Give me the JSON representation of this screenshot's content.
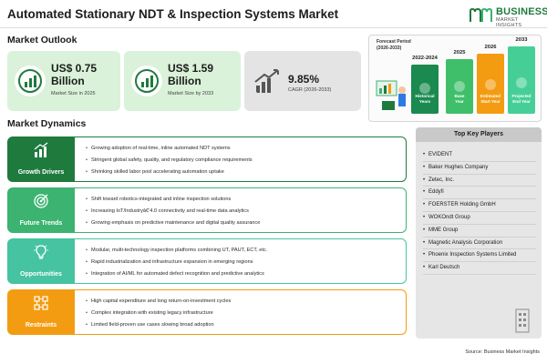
{
  "title": "Automated Stationary NDT & Inspection Systems Market",
  "logo": {
    "line1": "BUSINESS",
    "line2": "MARKET INSIGHTS",
    "brand_color": "#1f7a3e"
  },
  "outlook": {
    "heading": "Market Outlook",
    "cards": [
      {
        "value": "US$ 0.75 Billion",
        "value_line1": "US$ 0.75",
        "value_line2": "Billion",
        "caption": "Market Size in 2025",
        "bg": "#d9f2d9",
        "icon": "chart-circle-icon"
      },
      {
        "value": "US$ 1.59 Billion",
        "value_line1": "US$ 1.59",
        "value_line2": "Billion",
        "caption": "Market Size by 2033",
        "bg": "#d9f2d9",
        "icon": "chart-circle-icon"
      },
      {
        "value": "9.85%",
        "caption": "CAGR (2026-2033)",
        "bg": "#e4e4e4",
        "icon": "trend-up-icon"
      }
    ]
  },
  "forecast": {
    "label_line1": "Forecast Period",
    "label_line2": "(2026-2033)",
    "bars": [
      {
        "year": "2022-2024",
        "text_line1": "Historical",
        "text_line2": "Years",
        "color": "#1a8a50"
      },
      {
        "year": "2025",
        "text_line1": "Base",
        "text_line2": "Year",
        "color": "#3fbf6a"
      },
      {
        "year": "2026",
        "text_line1": "Estimated",
        "text_line2": "Start Year",
        "color": "#f39c12"
      },
      {
        "year": "2033",
        "text_line1": "Projected",
        "text_line2": "End Year",
        "color": "#45cf96"
      }
    ]
  },
  "dynamics": {
    "heading": "Market Dynamics",
    "groups": [
      {
        "label": "Growth Drivers",
        "color": "#1f7a3e",
        "border": "#1f7a3e",
        "icon": "growth-chart-icon",
        "items": [
          "Growing adoption of real-time, inline automated NDT systems",
          "Stringent global safety, quality, and regulatory compliance requirements",
          "Shrinking skilled labor pool accelerating automation uptake"
        ]
      },
      {
        "label": "Future Trends",
        "color": "#3cb371",
        "border": "#3cb371",
        "icon": "target-icon",
        "items": [
          "Shift toward robotics-integrated and inline inspection solutions",
          "Increasing IoT/Industryâ€‘4.0 connectivity and real-time data analytics",
          "Growing emphasis on predictive maintenance and digital quality assurance"
        ]
      },
      {
        "label": "Opportunities",
        "color": "#46c3a0",
        "border": "#46c3a0",
        "icon": "lightbulb-icon",
        "items": [
          "Modular, multi-technology inspection platforms combining UT, PAUT, ECT, etc.",
          "Rapid industrialization and infrastructure expansion in emerging regions",
          "Integration of AI/ML for automated defect recognition and predictive analytics"
        ]
      },
      {
        "label": "Restraints",
        "color": "#f39c12",
        "border": "#f39c12",
        "icon": "warning-network-icon",
        "items": [
          "High capital expenditure and long return-on-investment cycles",
          "Complex integration with existing legacy infrastructure",
          "Limited field-proven use cases slowing broad adoption"
        ]
      }
    ]
  },
  "players": {
    "heading": "Top Key Players",
    "items": [
      "EVIDENT",
      "Baker Hughes Company",
      "Zetec, Inc.",
      "Eddyfi",
      "FOERSTER Holding GmbH",
      "WOKOndt Group",
      "MME Group",
      "Magnetic Analysis Corporation",
      "Phoenix Inspection Systems Limited",
      "Karl Deutsch"
    ]
  },
  "source": "Source: Business Market Insights"
}
